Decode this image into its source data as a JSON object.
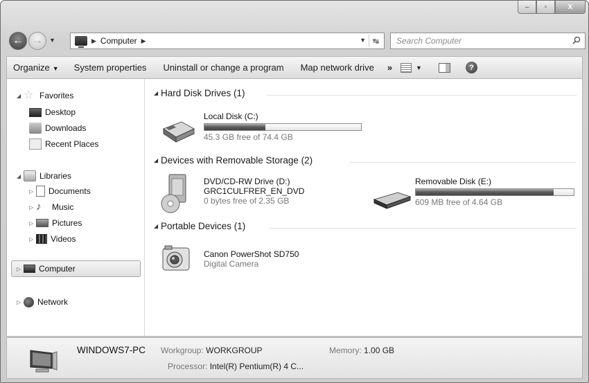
{
  "window": {
    "caption": {
      "minimize": "–",
      "maximize": "▫",
      "close": "X"
    }
  },
  "nav": {
    "breadcrumb": [
      "Computer"
    ],
    "search_placeholder": "Search Computer"
  },
  "commandbar": {
    "organize": "Organize",
    "system_properties": "System properties",
    "uninstall": "Uninstall or change a program",
    "map_drive": "Map network drive",
    "more": "»"
  },
  "sidebar": {
    "favorites": {
      "label": "Favorites",
      "items": [
        "Desktop",
        "Downloads",
        "Recent Places"
      ]
    },
    "libraries": {
      "label": "Libraries",
      "items": [
        "Documents",
        "Music",
        "Pictures",
        "Videos"
      ]
    },
    "computer": "Computer",
    "network": "Network"
  },
  "groups": [
    {
      "title": "Hard Disk Drives (1)",
      "items": [
        {
          "name": "Local Disk (C:)",
          "free_text": "45.3 GB free of 74.4 GB",
          "used_fraction": 0.391
        }
      ]
    },
    {
      "title": "Devices with Removable Storage (2)",
      "items": [
        {
          "name": "DVD/CD-RW Drive (D:)",
          "label": "GRC1CULFRER_EN_DVD",
          "free_text": "0 bytes free of 2.35 GB"
        },
        {
          "name": "Removable Disk (E:)",
          "free_text": "609 MB free of 4.64 GB",
          "used_fraction": 0.872
        }
      ]
    },
    {
      "title": "Portable Devices (1)",
      "items": [
        {
          "name": "Canon PowerShot SD750",
          "type": "Digital Camera"
        }
      ]
    }
  ],
  "details": {
    "computer_name": "WINDOWS7-PC",
    "workgroup_label": "Workgroup:",
    "workgroup": "WORKGROUP",
    "memory_label": "Memory:",
    "memory": "1.00 GB",
    "processor_label": "Processor:",
    "processor": "Intel(R) Pentium(R) 4 C..."
  }
}
